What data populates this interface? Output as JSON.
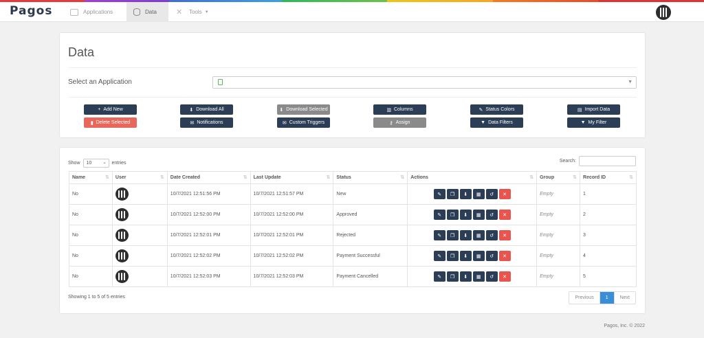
{
  "header": {
    "logo": "Pagos",
    "nav": [
      {
        "label": "Applications"
      },
      {
        "label": "Data"
      },
      {
        "label": "Tools"
      }
    ]
  },
  "page": {
    "title": "Data",
    "select_label": "Select an Application",
    "buttons_row1": [
      "Add New",
      "Download All",
      "Download Selected",
      "Columns",
      "Status Colors",
      "Import Data"
    ],
    "buttons_row2": [
      "Delete Selected",
      "Notifications",
      "Custom Triggers",
      "Assign",
      "Data Filters",
      "My Filter"
    ]
  },
  "table_controls": {
    "show_label": "Show",
    "entries_value": "10",
    "entries_label": "entries",
    "search_label": "Search:"
  },
  "table": {
    "columns": [
      "Name",
      "User",
      "Date Created",
      "Last Update",
      "Status",
      "Actions",
      "Group",
      "Record ID"
    ],
    "rows": [
      {
        "name": "No",
        "created": "10/7/2021 12:51:56 PM",
        "updated": "10/7/2021 12:51:57 PM",
        "status": "New",
        "group": "Empty",
        "id": "1"
      },
      {
        "name": "No",
        "created": "10/7/2021 12:52:00 PM",
        "updated": "10/7/2021 12:52:00 PM",
        "status": "Approved",
        "group": "Empty",
        "id": "2"
      },
      {
        "name": "No",
        "created": "10/7/2021 12:52:01 PM",
        "updated": "10/7/2021 12:52:01 PM",
        "status": "Rejected",
        "group": "Empty",
        "id": "3"
      },
      {
        "name": "No",
        "created": "10/7/2021 12:52:02 PM",
        "updated": "10/7/2021 12:52:02 PM",
        "status": "Payment Successful",
        "group": "Empty",
        "id": "4"
      },
      {
        "name": "No",
        "created": "10/7/2021 12:52:03 PM",
        "updated": "10/7/2021 12:52:03 PM",
        "status": "Payment Cancelled",
        "group": "Empty",
        "id": "5"
      }
    ]
  },
  "pagination": {
    "info": "Showing 1 to 5 of 5 entries",
    "previous": "Previous",
    "current": "1",
    "next": "Next"
  },
  "footer": "Pagos, Inc. © 2022"
}
